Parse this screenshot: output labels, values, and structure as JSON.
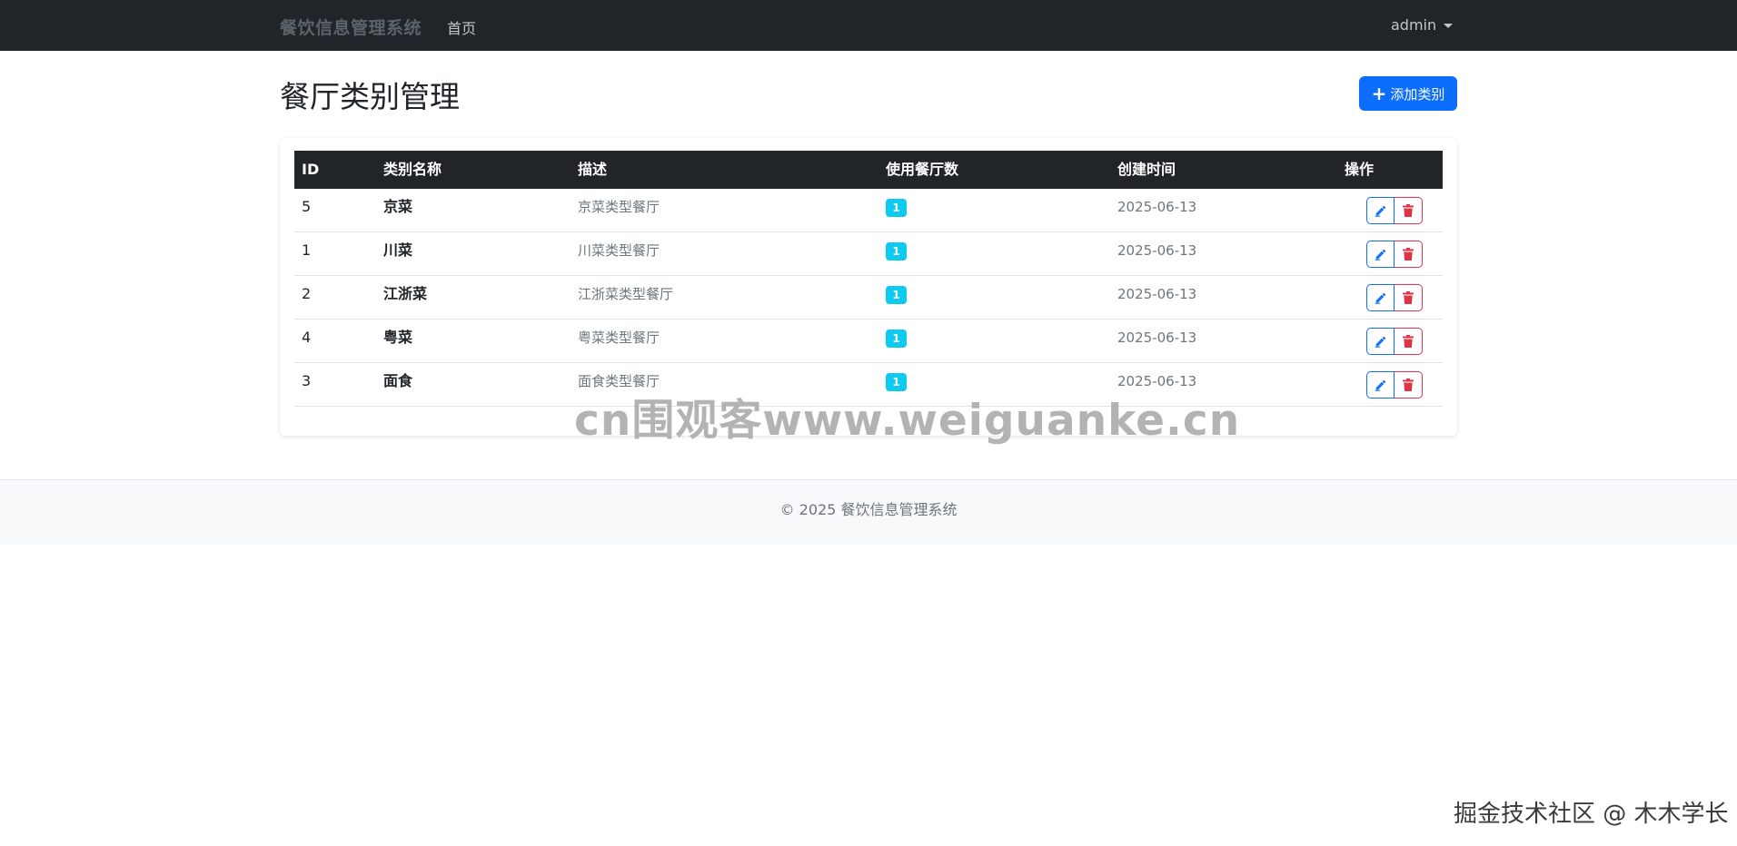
{
  "navbar": {
    "brand": "餐饮信息管理系统",
    "home": "首页",
    "user": "admin"
  },
  "page": {
    "title": "餐厅类别管理",
    "add_button": "添加类别",
    "add_icon": "plus-icon"
  },
  "table": {
    "headers": [
      "ID",
      "类别名称",
      "描述",
      "使用餐厅数",
      "创建时间",
      "操作"
    ],
    "rows": [
      {
        "id": "5",
        "name": "京菜",
        "desc": "京菜类型餐厅",
        "count": "1",
        "date": "2025-06-13"
      },
      {
        "id": "1",
        "name": "川菜",
        "desc": "川菜类型餐厅",
        "count": "1",
        "date": "2025-06-13"
      },
      {
        "id": "2",
        "name": "江浙菜",
        "desc": "江浙菜类型餐厅",
        "count": "1",
        "date": "2025-06-13"
      },
      {
        "id": "4",
        "name": "粤菜",
        "desc": "粤菜类型餐厅",
        "count": "1",
        "date": "2025-06-13"
      },
      {
        "id": "3",
        "name": "面食",
        "desc": "面食类型餐厅",
        "count": "1",
        "date": "2025-06-13"
      }
    ],
    "edit_icon": "edit-icon",
    "delete_icon": "trash-icon"
  },
  "footer": {
    "text": "© 2025 餐饮信息管理系统"
  },
  "watermarks": {
    "center": "cn围观客www.weiguanke.cn",
    "corner": "掘金技术社区 @ 木木学长"
  },
  "colors": {
    "navbar": "#212529",
    "primary": "#0d6efd",
    "danger": "#dc3545",
    "info": "#0dcaf0"
  }
}
